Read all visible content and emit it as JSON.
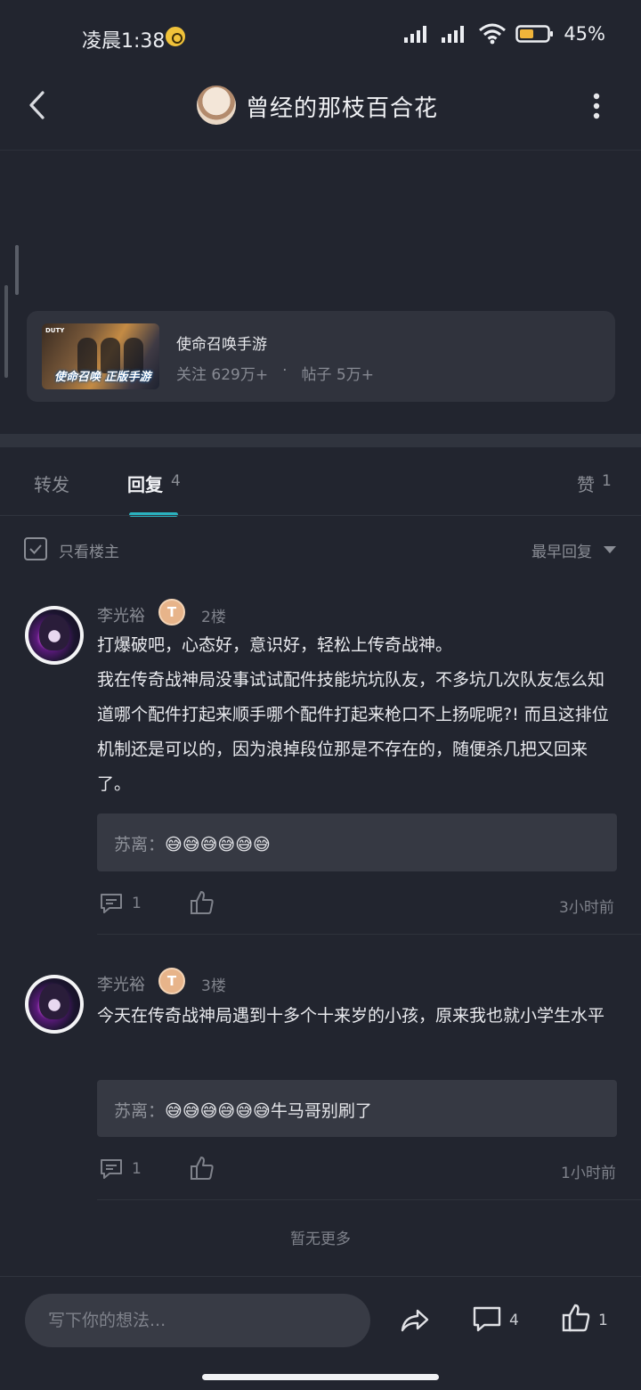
{
  "status_bar": {
    "time": "凌晨1:38",
    "battery": "45%"
  },
  "header": {
    "title": "曾经的那枝百合花"
  },
  "game_card": {
    "thumb_brand": "DUTY",
    "thumb_text": "使命召唤 正版手游",
    "name": "使命召唤手游",
    "followers": "关注 629万+",
    "separator": "·",
    "posts": "帖子 5万+"
  },
  "tabs": {
    "forward": "转发",
    "reply": "回复",
    "reply_count": "4",
    "like": "赞",
    "like_count": "1"
  },
  "filter": {
    "only_op": "只看楼主",
    "sort": "最早回复"
  },
  "comments": [
    {
      "username": "李光裕",
      "level": "T",
      "floor": "2楼",
      "text": "打爆破吧，心态好，意识好，轻松上传奇战神。\n我在传奇战神局没事试试配件技能坑坑队友，不多坑几次队友怎么知道哪个配件打起来顺手哪个配件打起来枪口不上扬呢呢?! 而且这排位机制还是可以的，因为浪掉段位那是不存在的，随便杀几把又回来了。",
      "reply_name": "苏离：",
      "reply_text": "😅😅😅😅😅😅",
      "reply_count": "1",
      "time": "3小时前"
    },
    {
      "username": "李光裕",
      "level": "T",
      "floor": "3楼",
      "text": "今天在传奇战神局遇到十多个十来岁的小孩，原来我也就小学生水平",
      "reply_name": "苏离：",
      "reply_text": "😅😅😅😅😅😅牛马哥别刷了",
      "reply_count": "1",
      "time": "1小时前"
    }
  ],
  "no_more": "暂无更多",
  "bottom_bar": {
    "input_placeholder": "写下你的想法...",
    "comment_count": "4",
    "like_count": "1"
  },
  "colors": {
    "background": "#22252f",
    "card": "#30333d",
    "accent": "#2bb3c0",
    "muted_text": "#8a8d95"
  },
  "icons": [
    "back-icon",
    "more-icon",
    "share-icon",
    "comment-icon",
    "like-icon",
    "checkbox-icon",
    "chevron-down-icon",
    "wifi-icon",
    "signal-icon",
    "battery-icon"
  ]
}
